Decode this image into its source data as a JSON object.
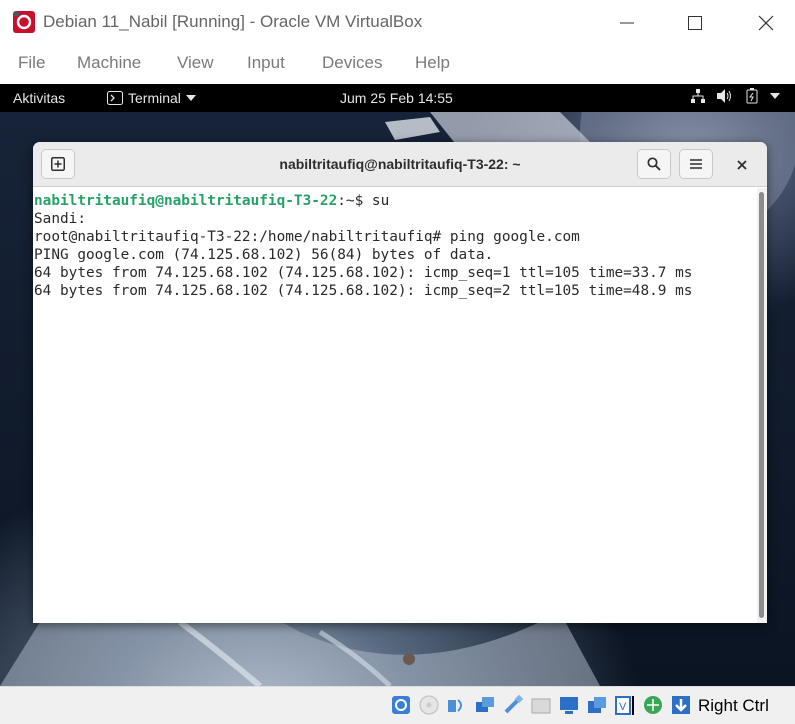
{
  "window": {
    "title": "Debian 11_Nabil [Running] - Oracle VM VirtualBox",
    "app_icon": "virtualbox-debian-icon",
    "controls": [
      "minimize-icon",
      "maximize-icon",
      "close-icon"
    ]
  },
  "menubar": {
    "items": [
      "File",
      "Machine",
      "View",
      "Input",
      "Devices",
      "Help"
    ]
  },
  "gnome": {
    "activities": "Aktivitas",
    "app_menu": "Terminal",
    "clock": "Jum 25 Feb  14:55",
    "tray_icons": [
      "network-icon",
      "volume-icon",
      "battery-icon",
      "power-menu-icon"
    ]
  },
  "terminal": {
    "title": "nabiltritaufiq@nabiltritaufiq-T3-22: ~",
    "header_buttons": [
      "new-tab-icon",
      "search-icon",
      "hamburger-menu-icon",
      "close-icon"
    ],
    "prompt_user": "nabiltritaufiq@nabiltritaufiq-T3-22",
    "prompt_path": ":~$ ",
    "command_1": "su",
    "lines": [
      "Sandi:",
      "root@nabiltritaufiq-T3-22:/home/nabiltritaufiq# ping google.com",
      "PING google.com (74.125.68.102) 56(84) bytes of data.",
      "64 bytes from 74.125.68.102 (74.125.68.102): icmp_seq=1 ttl=105 time=33.7 ms",
      "64 bytes from 74.125.68.102 (74.125.68.102): icmp_seq=2 ttl=105 time=48.9 ms"
    ]
  },
  "statusbar": {
    "icons": [
      "hard-disk-icon",
      "optical-drive-icon",
      "audio-icon",
      "network-adapter-icon",
      "usb-icon",
      "shared-folders-icon",
      "display-icon",
      "video-capture-icon",
      "recording-icon",
      "mouse-integration-icon",
      "keyboard-capture-icon"
    ],
    "host_key": "Right Ctrl"
  },
  "colors": {
    "prompt_green": "#26a269",
    "gnome_bar": "#000000",
    "terminal_header": "#ebebeb"
  }
}
